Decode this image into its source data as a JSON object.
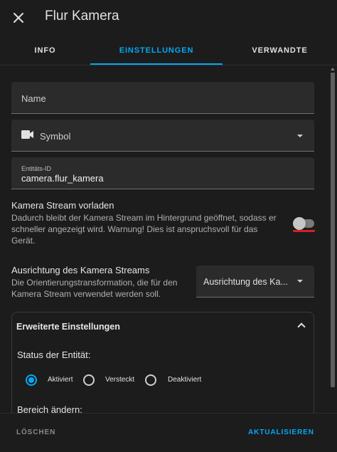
{
  "header": {
    "title": "Flur Kamera",
    "close_icon": "close-icon"
  },
  "tabs": [
    {
      "label": "INFO",
      "active": false
    },
    {
      "label": "EINSTELLUNGEN",
      "active": true
    },
    {
      "label": "VERWANDTE",
      "active": false
    }
  ],
  "form": {
    "name": {
      "label": "Name",
      "value": ""
    },
    "icon": {
      "label": "Symbol",
      "icon": "video-camera-icon"
    },
    "entity_id": {
      "label": "Entitäts-ID",
      "value": "camera.flur_kamera"
    }
  },
  "preload_stream": {
    "title": "Kamera Stream vorladen",
    "description_1": "Dadurch bleibt der Kamera Stream im Hintergrund geöffnet, sodass er",
    "description_2": "schneller angezeigt wird. Warnung! Dies ist anspruchsvoll für das",
    "description_3": "Gerät.",
    "enabled": false
  },
  "orientation": {
    "title": "Ausrichtung des Kamera Streams",
    "description_1": "Die Orientierungstransformation, die für den",
    "description_2": "Kamera Stream verwendet werden soll.",
    "select_label": "Ausrichtung des Ka..."
  },
  "advanced": {
    "title": "Erweiterte Einstellungen",
    "status_label": "Status der Entität:",
    "options": [
      "Aktiviert",
      "Versteckt",
      "Deaktiviert"
    ],
    "selected": "Aktiviert",
    "area_label": "Bereich ändern:"
  },
  "footer": {
    "delete_label": "LÖSCHEN",
    "update_label": "AKTUALISIEREN"
  },
  "colors": {
    "accent": "#03a9f4",
    "background": "#1c1c1c",
    "field": "#2b2b2b",
    "highlight": "#d71f23"
  }
}
